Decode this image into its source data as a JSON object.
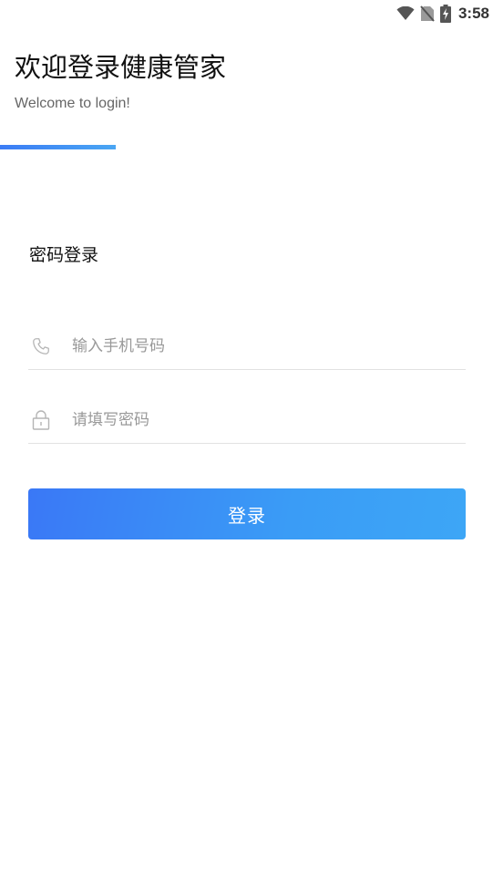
{
  "status_bar": {
    "time": "3:58",
    "icons": [
      "wifi-icon",
      "no-sim-icon",
      "battery-charging-icon"
    ]
  },
  "header": {
    "title": "欢迎登录健康管家",
    "subtitle": "Welcome to login!"
  },
  "login": {
    "mode_label": "密码登录",
    "phone_placeholder": "输入手机号码",
    "phone_value": "",
    "password_placeholder": "请填写密码",
    "password_value": "",
    "submit_label": "登录"
  },
  "colors": {
    "accent_start": "#3a78f6",
    "accent_end": "#3da6f6",
    "divider": "#e2e2e2",
    "placeholder": "#999999"
  }
}
